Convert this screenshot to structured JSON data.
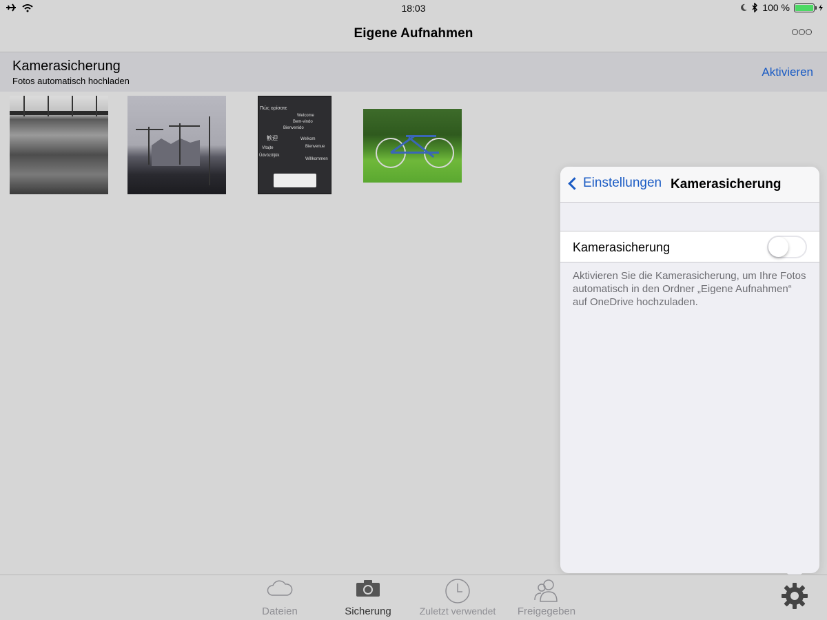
{
  "status_bar": {
    "time": "18:03",
    "battery_text": "100 %",
    "icons": [
      "airplane-icon",
      "wifi-icon",
      "moon-icon",
      "bluetooth-icon",
      "battery-icon"
    ]
  },
  "nav": {
    "title": "Eigene Aufnahmen",
    "more_icon": "more-icon"
  },
  "banner": {
    "title": "Kamerasicherung",
    "subtitle": "Fotos automatisch hochladen",
    "action": "Aktivieren"
  },
  "photo3_texts": [
    "Πώς ορίσατε",
    "Welcome",
    "Bem-vindo",
    "Bienvenido",
    "歓迎",
    "Welkom",
    "Bienvenue",
    "Vitajte",
    "Üdvözöljük",
    "Willkommen"
  ],
  "popover": {
    "back_label": "Einstellungen",
    "title": "Kamerasicherung",
    "setting_label": "Kamerasicherung",
    "toggle_on": false,
    "footer": "Aktivieren Sie die Kamerasicherung, um Ihre Fotos automatisch in den Ordner „Eigene Aufnahmen“ auf OneDrive hochzuladen."
  },
  "tabs": [
    {
      "label": "Dateien",
      "icon": "cloud-icon",
      "active": false
    },
    {
      "label": "Sicherung",
      "icon": "camera-icon",
      "active": true
    },
    {
      "label": "Zuletzt verwendet",
      "icon": "clock-icon",
      "active": false
    },
    {
      "label": "Freigegeben",
      "icon": "people-icon",
      "active": false
    }
  ],
  "settings_icon": "gear-icon",
  "colors": {
    "accent": "#1a5bc4",
    "battery": "#4cd964",
    "background": "#d6d6d6"
  }
}
